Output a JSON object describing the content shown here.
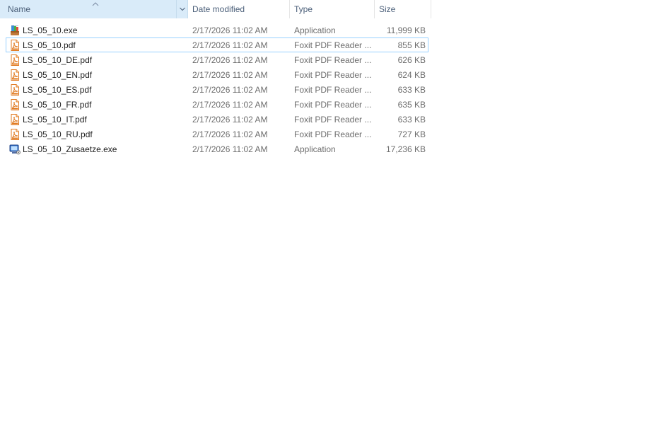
{
  "columns": {
    "name": "Name",
    "date": "Date modified",
    "type": "Type",
    "size": "Size"
  },
  "sort": {
    "column": "name",
    "direction": "ascending",
    "icon": "sort-up-chevron-icon"
  },
  "files": [
    {
      "name": "LS_05_10.exe",
      "date": "2/17/2026 11:02 AM",
      "type": "Application",
      "size": "11,999 KB",
      "icon": "installer-app-icon"
    },
    {
      "name": "LS_05_10.pdf",
      "date": "2/17/2026 11:02 AM",
      "type": "Foxit PDF Reader ...",
      "size": "855 KB",
      "icon": "pdf-file-icon",
      "focused": true
    },
    {
      "name": "LS_05_10_DE.pdf",
      "date": "2/17/2026 11:02 AM",
      "type": "Foxit PDF Reader ...",
      "size": "626 KB",
      "icon": "pdf-file-icon"
    },
    {
      "name": "LS_05_10_EN.pdf",
      "date": "2/17/2026 11:02 AM",
      "type": "Foxit PDF Reader ...",
      "size": "624 KB",
      "icon": "pdf-file-icon"
    },
    {
      "name": "LS_05_10_ES.pdf",
      "date": "2/17/2026 11:02 AM",
      "type": "Foxit PDF Reader ...",
      "size": "633 KB",
      "icon": "pdf-file-icon"
    },
    {
      "name": "LS_05_10_FR.pdf",
      "date": "2/17/2026 11:02 AM",
      "type": "Foxit PDF Reader ...",
      "size": "635 KB",
      "icon": "pdf-file-icon"
    },
    {
      "name": "LS_05_10_IT.pdf",
      "date": "2/17/2026 11:02 AM",
      "type": "Foxit PDF Reader ...",
      "size": "633 KB",
      "icon": "pdf-file-icon"
    },
    {
      "name": "LS_05_10_RU.pdf",
      "date": "2/17/2026 11:02 AM",
      "type": "Foxit PDF Reader ...",
      "size": "727 KB",
      "icon": "pdf-file-icon"
    },
    {
      "name": "LS_05_10_Zusaetze.exe",
      "date": "2/17/2026 11:02 AM",
      "type": "Application",
      "size": "17,236 KB",
      "icon": "setup-app-icon"
    }
  ],
  "colors": {
    "header_text": "#4c607a",
    "sorted_header_bg": "#d9ebf9",
    "focus_border": "#99d1ff",
    "pdf_orange": "#e0781e"
  }
}
